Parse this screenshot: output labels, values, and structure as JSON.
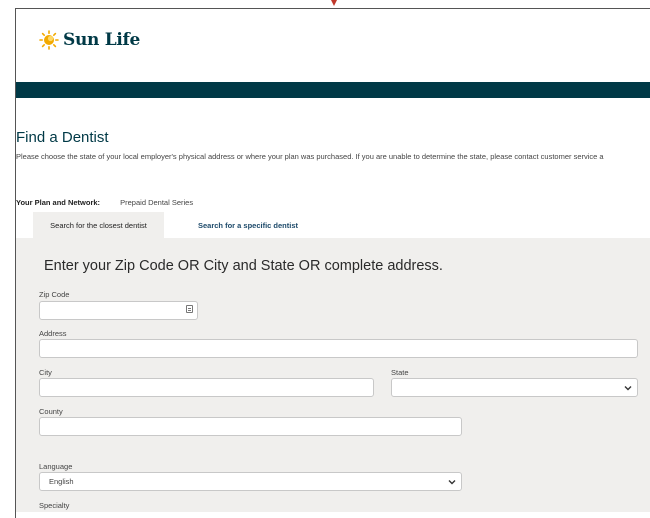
{
  "brand": {
    "name": "Sun Life"
  },
  "page": {
    "title": "Find a Dentist",
    "intro": "Please choose the state of your local employer's physical address or where your plan was purchased. If you are unable to determine the state, please contact customer service a"
  },
  "plan": {
    "label": "Your Plan and Network:",
    "value": "Prepaid Dental Series"
  },
  "tabs": [
    {
      "label": "Search for the closest dentist",
      "active": true
    },
    {
      "label": "Search for a specific dentist",
      "active": false
    }
  ],
  "form": {
    "heading": "Enter your Zip Code OR City and State OR complete address.",
    "zip_label": "Zip Code",
    "zip_value": "",
    "address_label": "Address",
    "address_value": "",
    "city_label": "City",
    "city_value": "",
    "state_label": "State",
    "state_value": "",
    "county_label": "County",
    "county_value": "",
    "language_label": "Language",
    "language_value": "English",
    "specialty_label": "Specialty"
  },
  "colors": {
    "brand_dark": "#003946",
    "panel_bg": "#f0efed",
    "logo_sun": "#f2a900"
  },
  "icons": [
    "sun-life-logo-icon",
    "card-icon",
    "chevron-down-icon"
  ]
}
